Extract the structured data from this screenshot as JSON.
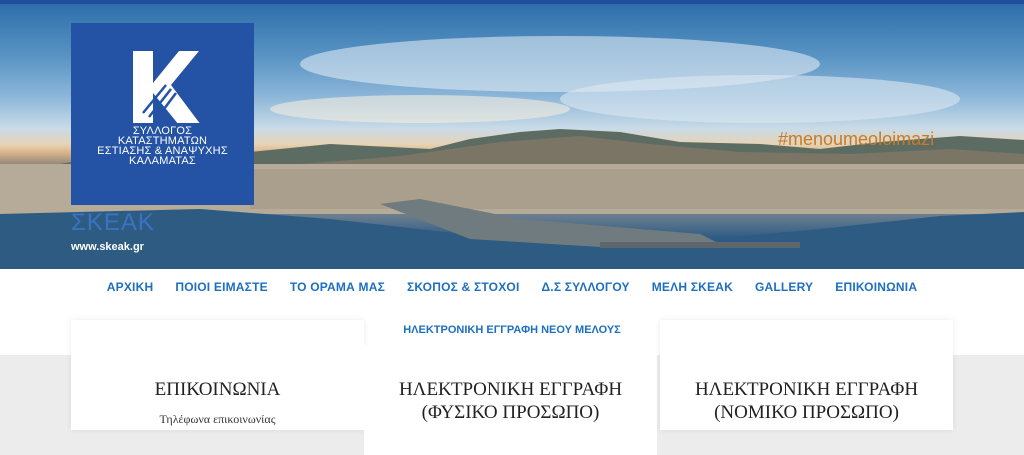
{
  "hero": {
    "logo_letter": "K",
    "logo_lines": [
      "ΣΥΛΛΟΓΟΣ",
      "ΚΑΤΑΣΤΗΜΑΤΩΝ",
      "ΕΣΤΙΑΣΗΣ & ΑΝΑΨΥΧΗΣ",
      "ΚΑΛΑΜΑΤΑΣ"
    ],
    "site_name": "ΣΚΕΑΚ",
    "site_url": "www.skeak.gr",
    "hashtag": "#menoumeoloimazi"
  },
  "nav": {
    "items": [
      {
        "label": "ΑΡΧΙΚΗ"
      },
      {
        "label": "ΠΟΙΟΙ ΕΙΜΑΣΤΕ"
      },
      {
        "label": "ΤΟ ΟΡΑΜΑ ΜΑΣ"
      },
      {
        "label": "ΣΚΟΠΟΣ & ΣΤΟΧΟΙ"
      },
      {
        "label": "Δ.Σ ΣΥΛΛΟΓΟΥ"
      },
      {
        "label": "ΜΕΛΗ ΣΚΕΑΚ"
      },
      {
        "label": "GALLERY"
      },
      {
        "label": "ΕΠΙΚΟΙΝΩΝΙΑ"
      }
    ],
    "sub_item": "ΗΛΕΚΤΡΟΝΙΚΗ ΕΓΓΡΑΦΗ ΝΕΟΥ ΜΕΛΟΥΣ"
  },
  "cards": [
    {
      "title_line1": "ΕΠΙΚΟΙΝΩΝΙΑ",
      "title_line2": "",
      "text": "Τηλέφωνα επικοινωνίας"
    },
    {
      "title_line1": "ΗΛΕΚΤΡΟΝΙΚΗ ΕΓΓΡΑΦΗ",
      "title_line2": "(ΦΥΣΙΚΟ ΠΡΟΣΩΠΟ)",
      "text": ""
    },
    {
      "title_line1": "ΗΛΕΚΤΡΟΝΙΚΗ ΕΓΓΡΑΦΗ",
      "title_line2": "(ΝΟΜΙΚΟ ΠΡΟΣΩΠΟ)",
      "text": ""
    }
  ]
}
